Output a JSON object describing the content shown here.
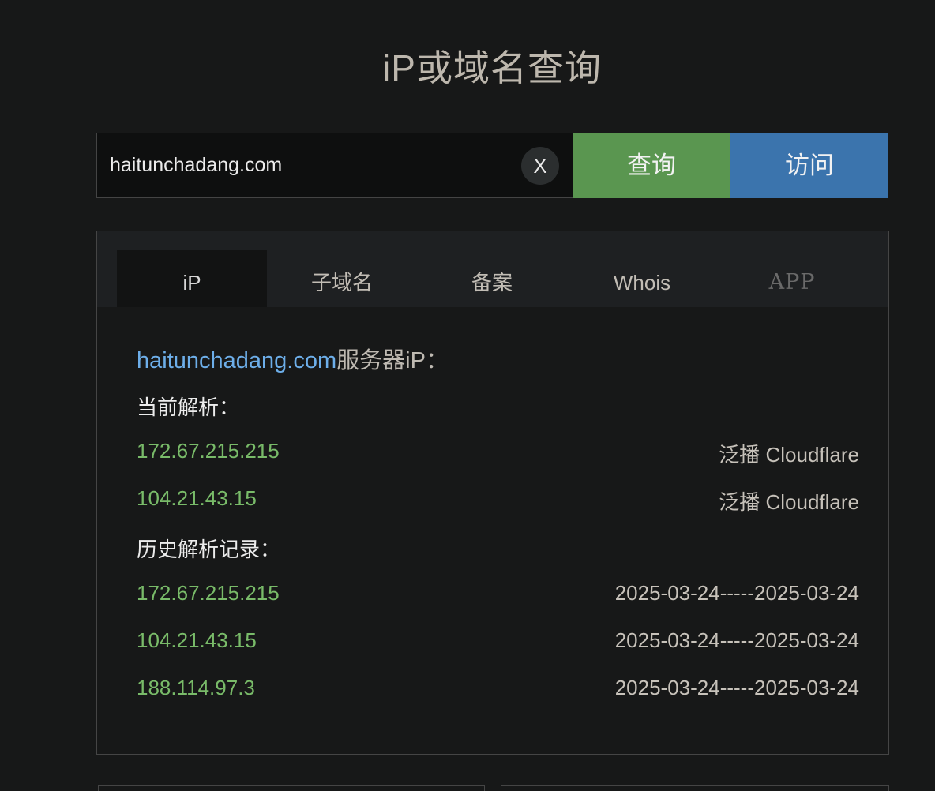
{
  "page": {
    "title": "iP或域名查询"
  },
  "search": {
    "value": "haitunchadang.com",
    "clear_label": "X",
    "query_label": "查询",
    "visit_label": "访问"
  },
  "tabs": [
    {
      "label": "iP",
      "active": true
    },
    {
      "label": "子域名",
      "active": false
    },
    {
      "label": "备案",
      "active": false
    },
    {
      "label": "Whois",
      "active": false
    },
    {
      "label": "APP",
      "active": false
    }
  ],
  "result": {
    "domain": "haitunchadang.com",
    "heading_suffix": "服务器iP：",
    "current_label": "当前解析：",
    "current": [
      {
        "ip": "172.67.215.215",
        "location": "泛播 Cloudflare"
      },
      {
        "ip": "104.21.43.15",
        "location": "泛播 Cloudflare"
      }
    ],
    "history_label": "历史解析记录：",
    "history": [
      {
        "ip": "172.67.215.215",
        "range": "2025-03-24-----2025-03-24"
      },
      {
        "ip": "104.21.43.15",
        "range": "2025-03-24-----2025-03-24"
      },
      {
        "ip": "188.114.97.3",
        "range": "2025-03-24-----2025-03-24"
      }
    ]
  },
  "colors": {
    "background": "#171818",
    "query_button": "#5a9650",
    "visit_button": "#3b74ad",
    "ip_green": "#79bb69",
    "link_blue": "#6daee9"
  }
}
